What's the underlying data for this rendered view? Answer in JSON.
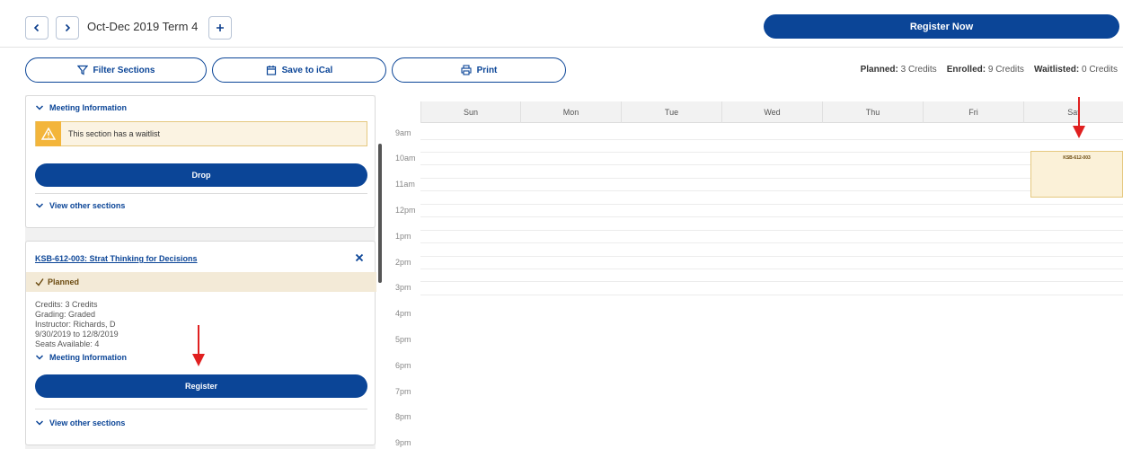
{
  "header": {
    "prev_icon": "chevron-left-icon",
    "next_icon": "chevron-right-icon",
    "term": "Oct-Dec 2019 Term 4",
    "add_icon": "plus-icon",
    "register_now_label": "Register Now"
  },
  "actions": {
    "filter_label": "Filter Sections",
    "ical_label": "Save to iCal",
    "print_label": "Print"
  },
  "credits": {
    "planned_label": "Planned:",
    "planned_value": "3 Credits",
    "enrolled_label": "Enrolled:",
    "enrolled_value": "9 Credits",
    "waitlisted_label": "Waitlisted:",
    "waitlisted_value": "0 Credits"
  },
  "section_one": {
    "meeting_info_label": "Meeting Information",
    "waitlist_notice": "This section has a waitlist",
    "warning_icon": "warning-icon",
    "drop_label": "Drop",
    "view_other_label": "View other sections"
  },
  "section_two": {
    "title": "KSB-612-003: Strat Thinking for Decisions",
    "close_icon": "close-icon",
    "status": "Planned",
    "credits": "Credits: 3 Credits",
    "grading": "Grading: Graded",
    "instructor": "Instructor: Richards, D",
    "dates": "9/30/2019 to 12/8/2019",
    "seats": "Seats Available:  4",
    "meeting_info_label": "Meeting Information",
    "register_label": "Register",
    "view_other_label": "View other sections"
  },
  "calendar": {
    "days": [
      "Sun",
      "Mon",
      "Tue",
      "Wed",
      "Thu",
      "Fri",
      "Sat"
    ],
    "hours": [
      "9am",
      "10am",
      "11am",
      "12pm",
      "1pm",
      "2pm",
      "3pm",
      "4pm",
      "5pm",
      "6pm",
      "7pm",
      "8pm",
      "9pm"
    ],
    "event_label": "KSB-612-003"
  },
  "colors": {
    "primary": "#0b4597",
    "warning": "#f3b53b",
    "planned_bg": "#f3ead7",
    "annotation_arrow": "#e02020"
  }
}
